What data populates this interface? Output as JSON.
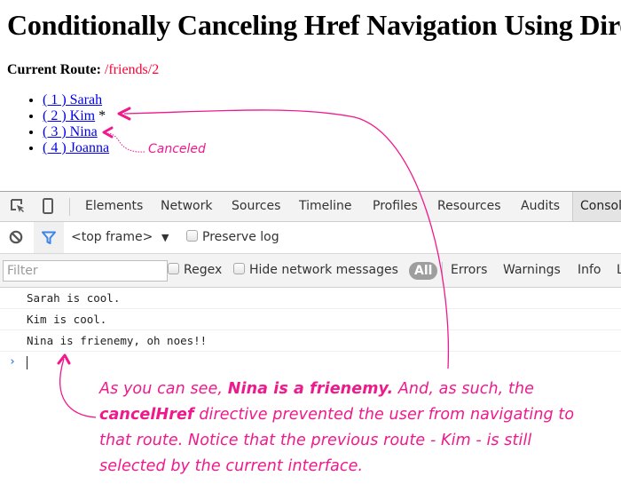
{
  "page": {
    "title": "Conditionally Canceling Href Navigation Using Directives",
    "current_route_label": "Current Route:",
    "current_route_value": "/friends/2",
    "friends": [
      {
        "label": "( 1 ) Sarah",
        "marker": ""
      },
      {
        "label": "( 2 ) Kim",
        "marker": "*"
      },
      {
        "label": "( 3 ) Nina",
        "marker": ""
      },
      {
        "label": "( 4 ) Joanna",
        "marker": ""
      }
    ]
  },
  "devtools": {
    "icons": {
      "inspect": "inspect-element-icon",
      "device": "device-mode-icon",
      "clear": "clear-console-icon",
      "filter": "filter-icon"
    },
    "tabs": [
      "Elements",
      "Network",
      "Sources",
      "Timeline",
      "Profiles",
      "Resources",
      "Audits",
      "Console"
    ],
    "active_tab": "Console",
    "frame_selector": "<top frame>",
    "preserve_log_label": "Preserve log",
    "filter_placeholder": "Filter",
    "regex_label": "Regex",
    "hide_network_label": "Hide network messages",
    "levels": [
      "All",
      "Errors",
      "Warnings",
      "Info",
      "Logs"
    ],
    "active_level": "All",
    "console_messages": [
      "Sarah is cool.",
      "Kim is cool.",
      "Nina is frienemy, oh noes!!"
    ],
    "prompt_symbol": "›"
  },
  "annotations": {
    "canceled_label": "Canceled",
    "note_line1_pre": "As you can see, ",
    "note_line1_bold": "Nina is a frienemy.",
    "note_line1_post": " And, as such, the",
    "note_line2_bold": "cancelHref",
    "note_line2_post": " directive prevented the user from navigating to",
    "note_line3": "that route. Notice that the previous route - Kim - is still",
    "note_line4": "selected by the current interface.",
    "accent_color": "#f0198c"
  }
}
